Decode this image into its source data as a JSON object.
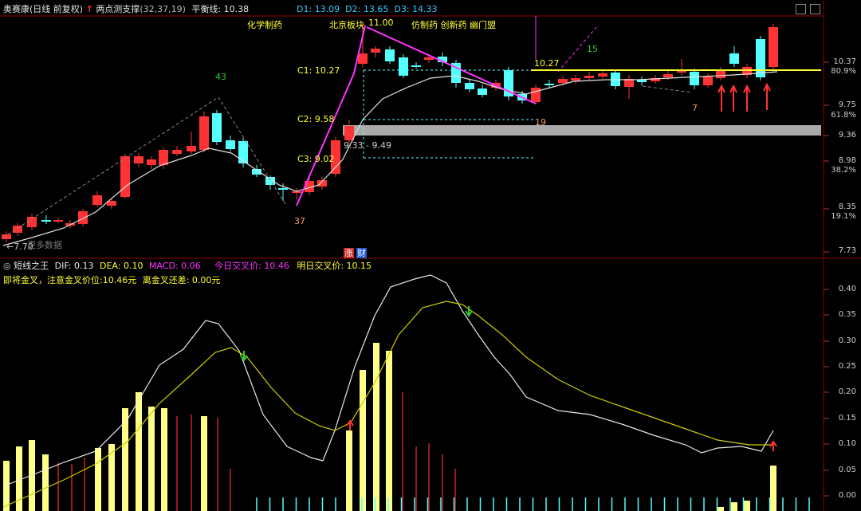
{
  "header": {
    "stock_name": "奥赛康",
    "period_info": "(日线 前复权)",
    "indicator_name": "两点测支撑",
    "indicator_params": "(32,37,19)",
    "balance_label": "平衡线:",
    "balance_value": "10.38",
    "d1": "D1: 13.09",
    "d2": "D2: 13.65",
    "d3": "D3: 14.33"
  },
  "annotations": {
    "sector1": "化学制药",
    "sector2": "北京板块",
    "sector3": "仿制药 创新药 幽门盟",
    "c1": "C1: 10.27",
    "c2": "C2: 9.58",
    "c3": "C3: 9.02",
    "range": "9.33 - 9.49",
    "count_43": "43",
    "count_37": "37",
    "count_11": "11.00",
    "count_19": "19",
    "count_15": "15",
    "count_7": "7",
    "price_1027": "10.27",
    "low_price": "←7.70",
    "chip_label": "更多数据",
    "badge_zhang": "涨",
    "badge_cai": "财"
  },
  "price_axis": {
    "labels": [
      "10.37",
      "80.9%",
      "9.75",
      "61.8%",
      "9.36",
      "8.98",
      "38.2%",
      "8.35",
      "19.1%",
      "7.73"
    ]
  },
  "macd_header": {
    "name": "短线之王",
    "dif": "DIF: 0.13",
    "dea": "DEA: 0.10",
    "macd": "MACD: 0.06",
    "today_cross": "今日交叉价: 10.46",
    "tomorrow_cross": "明日交叉价: 10.15",
    "line2": "即将金叉，注意金叉价位:10.46元",
    "line2b": "离金叉还差: 0.00元"
  },
  "macd_axis": {
    "labels": [
      "0.40",
      "0.35",
      "0.30",
      "0.25",
      "0.20",
      "0.15",
      "0.10",
      "0.05",
      "0.00"
    ]
  },
  "colors": {
    "up": "#ff3333",
    "down": "#54ffff",
    "yellow": "#ffff33",
    "magenta": "#ff33ff",
    "grid": "#8b0000"
  }
}
